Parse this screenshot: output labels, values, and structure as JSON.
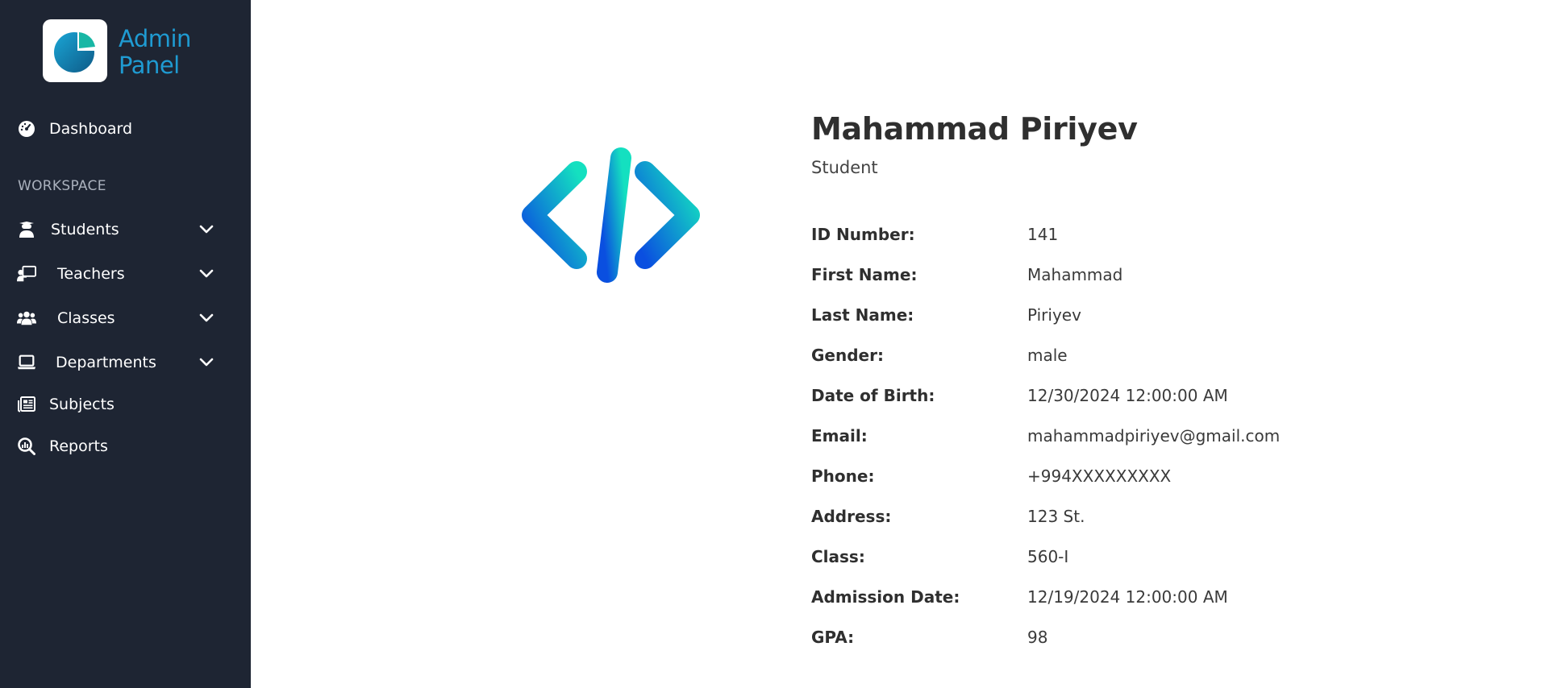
{
  "app": {
    "title_line1": "Admin",
    "title_line2": "Panel"
  },
  "sidebar": {
    "dashboard": {
      "label": "Dashboard",
      "icon": "gauge-icon"
    },
    "section_label": "WORKSPACE",
    "items": [
      {
        "label": "Students",
        "icon": "student-icon",
        "has_submenu": true
      },
      {
        "label": "Teachers",
        "icon": "chalkboard-teacher-icon",
        "has_submenu": true
      },
      {
        "label": "Classes",
        "icon": "users-icon",
        "has_submenu": true
      },
      {
        "label": "Departments",
        "icon": "laptop-icon",
        "has_submenu": true
      },
      {
        "label": "Subjects",
        "icon": "newspaper-icon",
        "has_submenu": false
      },
      {
        "label": "Reports",
        "icon": "magnifier-chart-icon",
        "has_submenu": false
      }
    ]
  },
  "profile": {
    "name": "Mahammad Piriyev",
    "role": "Student",
    "fields": [
      {
        "key": "ID Number:",
        "value": "141"
      },
      {
        "key": "First Name:",
        "value": "Mahammad"
      },
      {
        "key": "Last Name:",
        "value": "Piriyev"
      },
      {
        "key": "Gender:",
        "value": "male"
      },
      {
        "key": "Date of Birth:",
        "value": "12/30/2024 12:00:00 AM"
      },
      {
        "key": "Email:",
        "value": "mahammadpiriyev@gmail.com"
      },
      {
        "key": "Phone:",
        "value": "+994XXXXXXXXX"
      },
      {
        "key": "Address:",
        "value": "123 St."
      },
      {
        "key": "Class:",
        "value": "560-I"
      },
      {
        "key": "Admission Date:",
        "value": "12/19/2024 12:00:00 AM"
      },
      {
        "key": "GPA:",
        "value": "98"
      }
    ]
  },
  "colors": {
    "sidebar_bg": "#1e2533",
    "brand": "#1f9bd2",
    "accent_teal": "#12c9b7",
    "accent_blue": "#0a5fe0"
  }
}
